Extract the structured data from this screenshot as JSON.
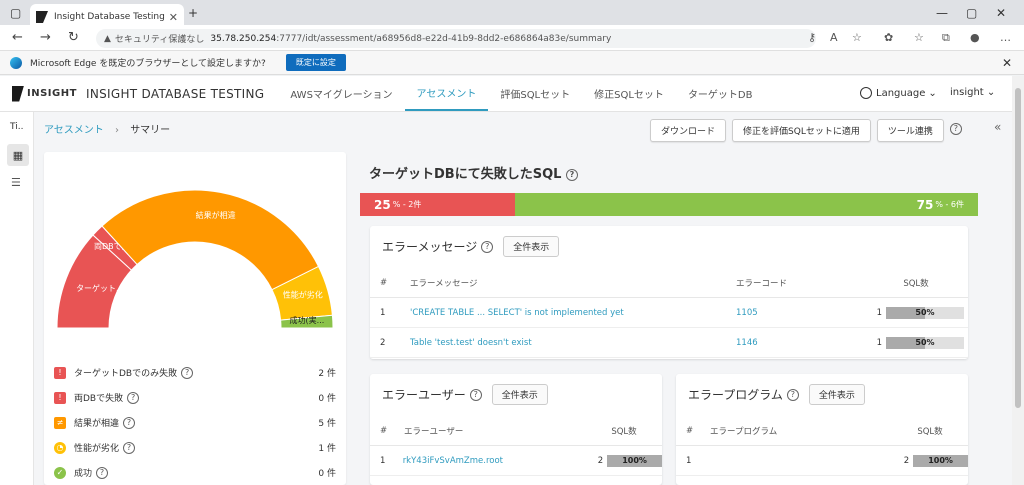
{
  "browser": {
    "tab_title": "Insight Database Testing",
    "security_text": "セキュリティ保護なし",
    "url_host": "35.78.250.254",
    "url_rest": ":7777/idt/assessment/a68956d8-e22d-41b9-8dd2-e686864a83e/summary",
    "infobar_text": "Microsoft Edge を既定のブラウザーとして設定しますか?",
    "infobar_button": "既定に設定"
  },
  "app": {
    "logo": "INSIGHT",
    "brand": "INSIGHT DATABASE TESTING",
    "menu": [
      {
        "label": "AWSマイグレーション"
      },
      {
        "label": "アセスメント"
      },
      {
        "label": "評価SQLセット"
      },
      {
        "label": "修正SQLセット"
      },
      {
        "label": "ターゲットDB"
      }
    ],
    "active_menu": "アセスメント",
    "language": "Language",
    "user": "insight"
  },
  "rail": {
    "top_label": "Ti.."
  },
  "breadcrumb": {
    "parent": "アセスメント",
    "current": "サマリー"
  },
  "actions": {
    "download": "ダウンロード",
    "apply": "修正を評価SQLセットに適用",
    "tool": "ツール連携"
  },
  "gauge": {
    "segments": [
      {
        "label": "ターゲット...",
        "count": 2,
        "color": "#e85454"
      },
      {
        "label": "両DBで失敗",
        "count": 0,
        "color": "#e85454"
      },
      {
        "label": "結果が相違",
        "count": 5,
        "color": "#ff9800"
      },
      {
        "label": "性能が劣化",
        "count": 1,
        "color": "#ffc107"
      },
      {
        "label": "成功(実...",
        "count": 0,
        "color": "#8bc34a"
      }
    ]
  },
  "legend": [
    {
      "label": "ターゲットDBでのみ失敗",
      "count": "2 件",
      "color": "#e85454",
      "icon": "!"
    },
    {
      "label": "両DBで失敗",
      "count": "0 件",
      "color": "#e85454",
      "icon": "!"
    },
    {
      "label": "結果が相違",
      "count": "5 件",
      "color": "#ff9800",
      "icon": "≠"
    },
    {
      "label": "性能が劣化",
      "count": "1 件",
      "color": "#ffc107",
      "icon": "◔"
    },
    {
      "label": "成功",
      "count": "0 件",
      "color": "#8bc34a",
      "icon": "✓"
    }
  ],
  "failed": {
    "title": "ターゲットDBにて失敗したSQL",
    "fail_pct": "25",
    "fail_unit": "% - 2件",
    "ok_pct": "75",
    "ok_unit": "% - 6件",
    "fail_fraction": 0.25
  },
  "errors": {
    "title": "エラーメッセージ",
    "show_all": "全件表示",
    "headers": [
      "#",
      "エラーメッセージ",
      "エラーコード",
      "SQL数"
    ],
    "rows": [
      {
        "n": "1",
        "msg": "'CREATE TABLE ... SELECT' is not implemented yet",
        "code": "1105",
        "count": "1",
        "pct": "50%",
        "frac": 0.5
      },
      {
        "n": "2",
        "msg": "Table 'test.test' doesn't exist",
        "code": "1146",
        "count": "1",
        "pct": "50%",
        "frac": 0.5
      }
    ]
  },
  "users": {
    "title": "エラーユーザー",
    "show_all": "全件表示",
    "headers": [
      "#",
      "エラーユーザー",
      "SQL数"
    ],
    "rows": [
      {
        "n": "1",
        "name": "rkY43iFvSvAmZme.root",
        "count": "2",
        "pct": "100%",
        "frac": 1.0
      }
    ]
  },
  "programs": {
    "title": "エラープログラム",
    "show_all": "全件表示",
    "headers": [
      "#",
      "エラープログラム",
      "SQL数"
    ],
    "rows": [
      {
        "n": "1",
        "name": "",
        "count": "2",
        "pct": "100%",
        "frac": 1.0
      }
    ]
  }
}
